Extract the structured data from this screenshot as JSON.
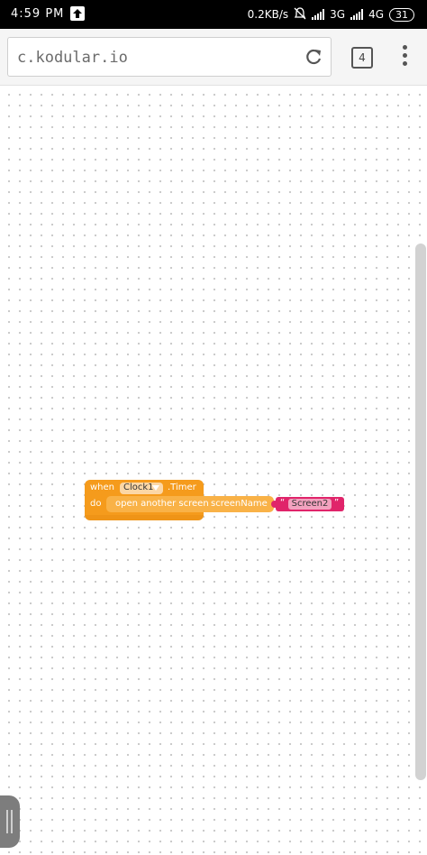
{
  "status_bar": {
    "time": "4:59 PM",
    "speed": "0.2KB/s",
    "net1": "3G",
    "net2": "4G",
    "battery": "31"
  },
  "browser": {
    "url": "c.kodular.io",
    "tab_count": "4"
  },
  "block": {
    "when_label": "when",
    "component": "Clock1",
    "event": ".Timer",
    "do_label": "do",
    "method": "open another screen",
    "param": "screenName",
    "quote_left": "“",
    "value": "Screen2",
    "quote_right": "”"
  },
  "colors": {
    "event_block": "#f59b1c",
    "call_block": "#f9b247",
    "text_block": "#e0246a"
  }
}
